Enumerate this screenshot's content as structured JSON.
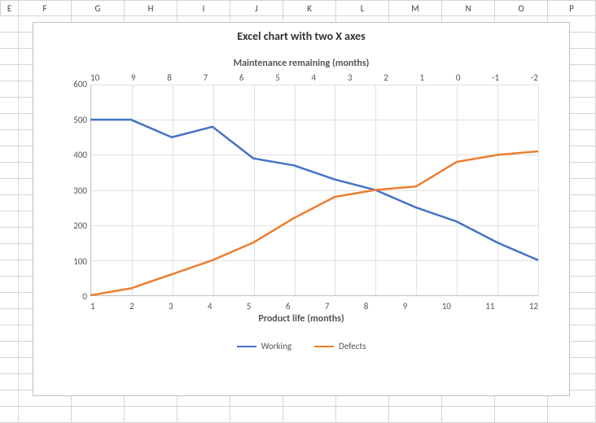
{
  "columns": [
    "E",
    "F",
    "G",
    "H",
    "I",
    "J",
    "K",
    "L",
    "M",
    "N",
    "O",
    "P"
  ],
  "chart_data": {
    "type": "line",
    "title": "Excel chart with two X axes",
    "secondary_x_label": "Maintenance remaining (months)",
    "primary_x_label": "Product life (months)",
    "primary_x_ticks": [
      1,
      2,
      3,
      4,
      5,
      6,
      7,
      8,
      9,
      10,
      11,
      12
    ],
    "secondary_x_ticks": [
      10,
      9,
      8,
      7,
      6,
      5,
      4,
      3,
      2,
      1,
      0,
      -1,
      -2
    ],
    "y_ticks": [
      600,
      500,
      400,
      300,
      200,
      100,
      0
    ],
    "ylim": [
      0,
      600
    ],
    "series": [
      {
        "name": "Working",
        "color": "#4472c4",
        "x": [
          1,
          2,
          3,
          4,
          5,
          6,
          7,
          8,
          9,
          10,
          11,
          12
        ],
        "values": [
          500,
          500,
          450,
          480,
          390,
          370,
          330,
          300,
          250,
          210,
          150,
          100
        ]
      },
      {
        "name": "Defects",
        "color": "#ed7d31",
        "x": [
          1,
          2,
          3,
          4,
          5,
          6,
          7,
          8,
          9,
          10,
          11,
          12
        ],
        "values": [
          0,
          20,
          60,
          100,
          150,
          220,
          280,
          300,
          310,
          380,
          400,
          410
        ]
      }
    ]
  },
  "legend": {
    "working": "Working",
    "defects": "Defects"
  }
}
